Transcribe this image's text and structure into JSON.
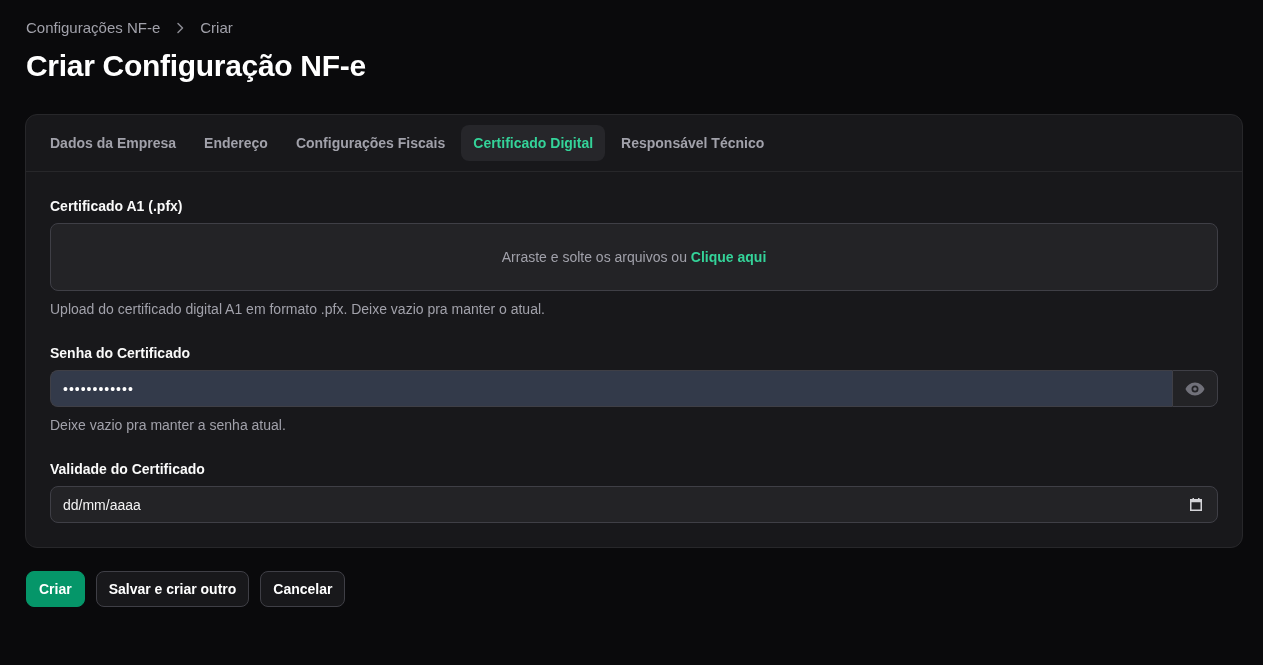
{
  "breadcrumbs": [
    {
      "label": "Configurações NF-e"
    },
    {
      "label": "Criar"
    }
  ],
  "title": "Criar Configuração NF-e",
  "tabs": [
    {
      "label": "Dados da Empresa",
      "selected": false
    },
    {
      "label": "Endereço",
      "selected": false
    },
    {
      "label": "Configurações Fiscais",
      "selected": false
    },
    {
      "label": "Certificado Digital",
      "selected": true
    },
    {
      "label": "Responsável Técnico",
      "selected": false
    }
  ],
  "fields": [
    {
      "kind": "upload",
      "label": "Certificado A1 (.pfx)",
      "prompt": "Arraste e solte os arquivos ou",
      "link": "Clique aqui",
      "hint": "Upload do certificado digital A1 em formato .pfx. Deixe vazio pra manter o atual."
    },
    {
      "kind": "password",
      "label": "Senha do Certificado",
      "value": "••••••••••••",
      "hint": "Deixe vazio pra manter a senha atual."
    },
    {
      "kind": "date",
      "label": "Validade do Certificado",
      "placeholder": "dd/mm/aaaa"
    }
  ],
  "buttons": [
    {
      "label": "Criar",
      "kind": "primary"
    },
    {
      "label": "Salvar e criar outro",
      "kind": "secondary"
    },
    {
      "label": "Cancelar",
      "kind": "secondary"
    }
  ]
}
